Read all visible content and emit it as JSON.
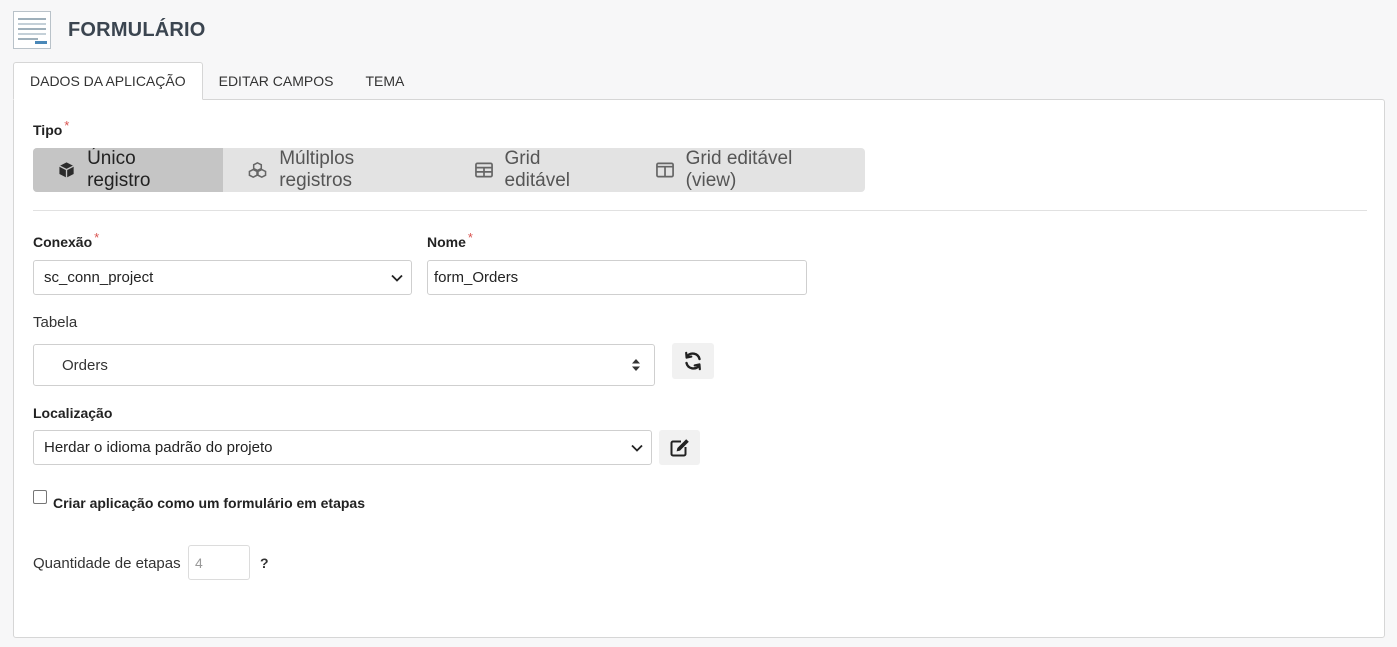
{
  "header": {
    "title": "FORMULÁRIO",
    "icon": "form-document-icon"
  },
  "tabs": [
    {
      "label": "DADOS DA APLICAÇÃO",
      "active": true
    },
    {
      "label": "EDITAR CAMPOS",
      "active": false
    },
    {
      "label": "TEMA",
      "active": false
    }
  ],
  "tipo": {
    "label": "Tipo",
    "required_mark": "*",
    "options": [
      {
        "label": "Único registro",
        "icon": "cube-icon",
        "active": true
      },
      {
        "label": "Múltiplos registros",
        "icon": "cubes-icon",
        "active": false
      },
      {
        "label": "Grid editável",
        "icon": "table-icon",
        "active": false
      },
      {
        "label": "Grid editável (view)",
        "icon": "columns-icon",
        "active": false
      }
    ]
  },
  "conexao": {
    "label": "Conexão",
    "required_mark": "*",
    "value": "sc_conn_project"
  },
  "nome": {
    "label": "Nome",
    "required_mark": "*",
    "value": "form_Orders"
  },
  "tabela": {
    "label": "Tabela",
    "value": "Orders",
    "refresh_icon": "refresh-icon"
  },
  "localizacao": {
    "label": "Localização",
    "value": "Herdar o idioma padrão do projeto",
    "edit_icon": "edit-icon"
  },
  "etapas": {
    "checkbox_label": "Criar aplicação como um formulário em etapas",
    "checked": false
  },
  "quantidade": {
    "label": "Quantidade de etapas",
    "value": "4",
    "help": "?"
  },
  "colors": {
    "accent_required": "#d9534f",
    "segment_bg": "#e3e3e3",
    "segment_active_bg": "#c5c5c5"
  }
}
